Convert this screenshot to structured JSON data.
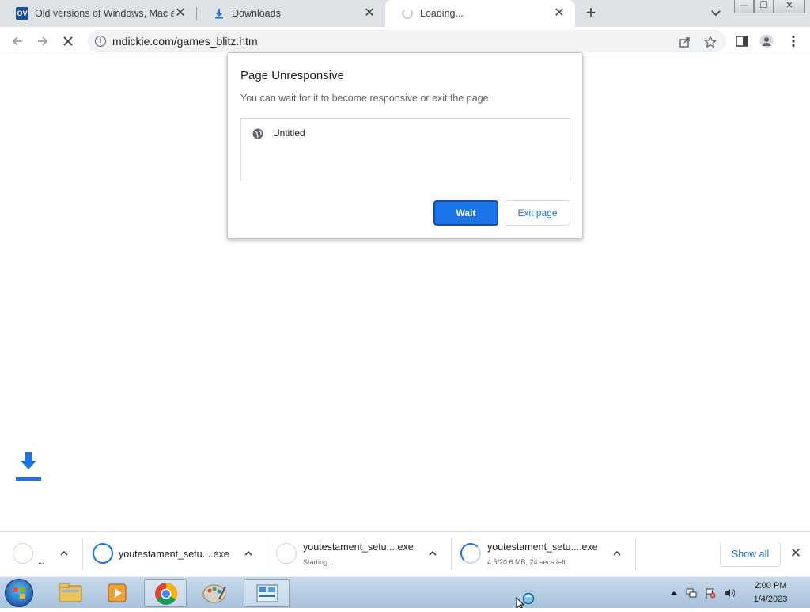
{
  "browser": {
    "tabs": [
      {
        "title": "Old versions of Windows, Mac and Linux software",
        "favicon": "OV",
        "close": "✕"
      },
      {
        "title": "Downloads",
        "favicon": "download-icon",
        "close": "✕"
      },
      {
        "title": "Loading...",
        "favicon": "loading-spinner",
        "close": "✕",
        "active": true
      }
    ],
    "new_tab": "+",
    "window_controls": {
      "minimize": "—",
      "restore": "❐",
      "close": "✕"
    },
    "url": "mdickie.com/games_blitz.htm"
  },
  "dialog": {
    "title": "Page Unresponsive",
    "message": "You can wait for it to become responsive or exit the page.",
    "pages": [
      "Untitled"
    ],
    "wait_label": "Wait",
    "exit_label": "Exit page"
  },
  "downloads": {
    "items": [
      {
        "name": "...",
        "status": ""
      },
      {
        "name": "youtestament_setu....exe",
        "status": ""
      },
      {
        "name": "youtestament_setu....exe",
        "status": "Starting..."
      },
      {
        "name": "youtestament_setu....exe",
        "status": "4.5/20.6 MB, 24 secs left"
      }
    ],
    "show_all_label": "Show all",
    "close": "✕"
  },
  "taskbar": {
    "time": "2:00 PM",
    "date": "1/4/2023"
  },
  "colors": {
    "accent": "#1a73e8",
    "tabstrip": "#dee1e6",
    "taskbar": "#b4cbe1"
  }
}
